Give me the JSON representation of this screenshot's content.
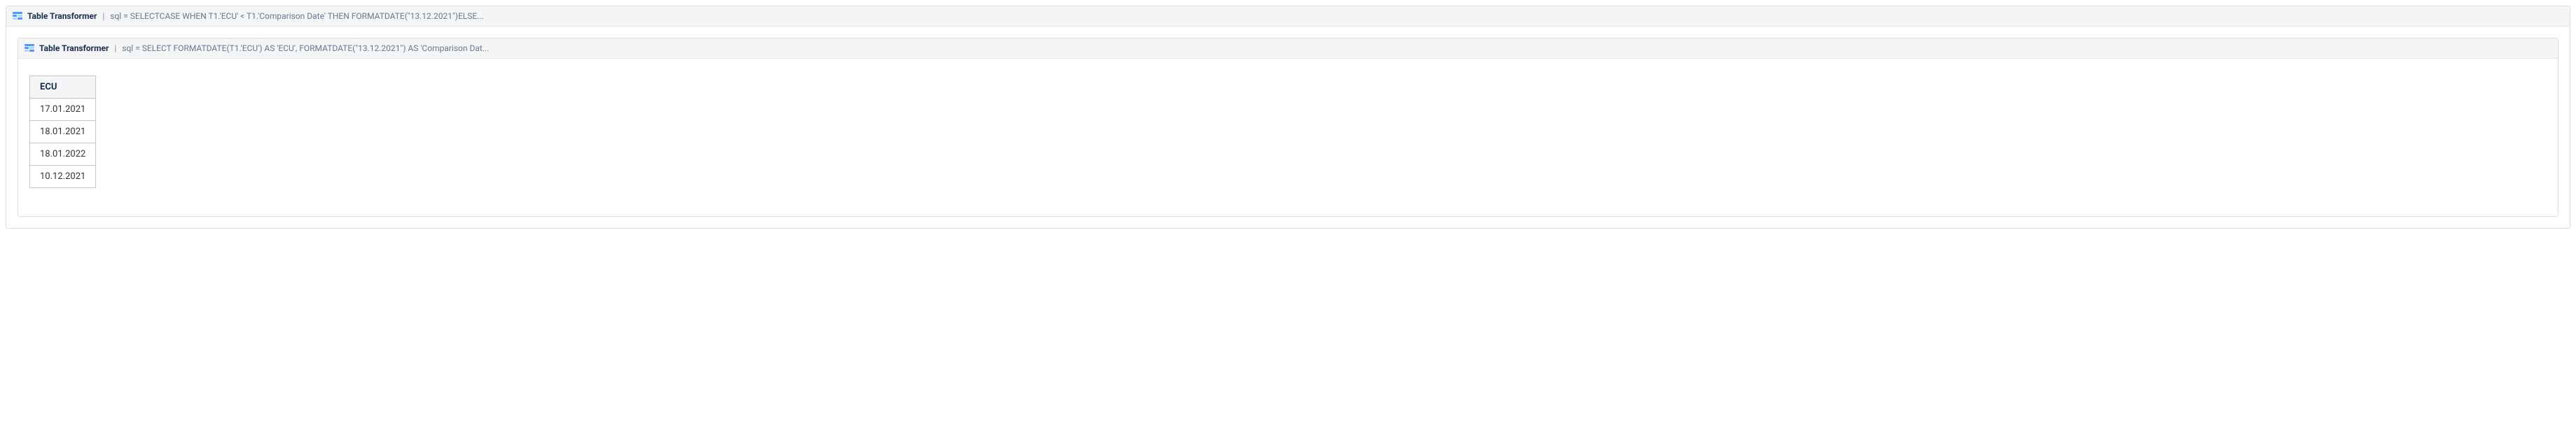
{
  "outer_macro": {
    "title": "Table Transformer",
    "param_prefix": "sql = ",
    "param_value": "SELECTCASE WHEN T1.'ECU' < T1.'Comparison Date' THEN FORMATDATE(\"13.12.2021\")ELSE..."
  },
  "inner_macro": {
    "title": "Table Transformer",
    "param_prefix": "sql = ",
    "param_value": "SELECT FORMATDATE(T1.'ECU') AS 'ECU', FORMATDATE(\"13.12.2021\") AS 'Comparison Dat..."
  },
  "chart_data": {
    "type": "table",
    "columns": [
      "ECU"
    ],
    "rows": [
      [
        "17.01.2021"
      ],
      [
        "18.01.2021"
      ],
      [
        "18.01.2022"
      ],
      [
        "10.12.2021"
      ]
    ]
  }
}
